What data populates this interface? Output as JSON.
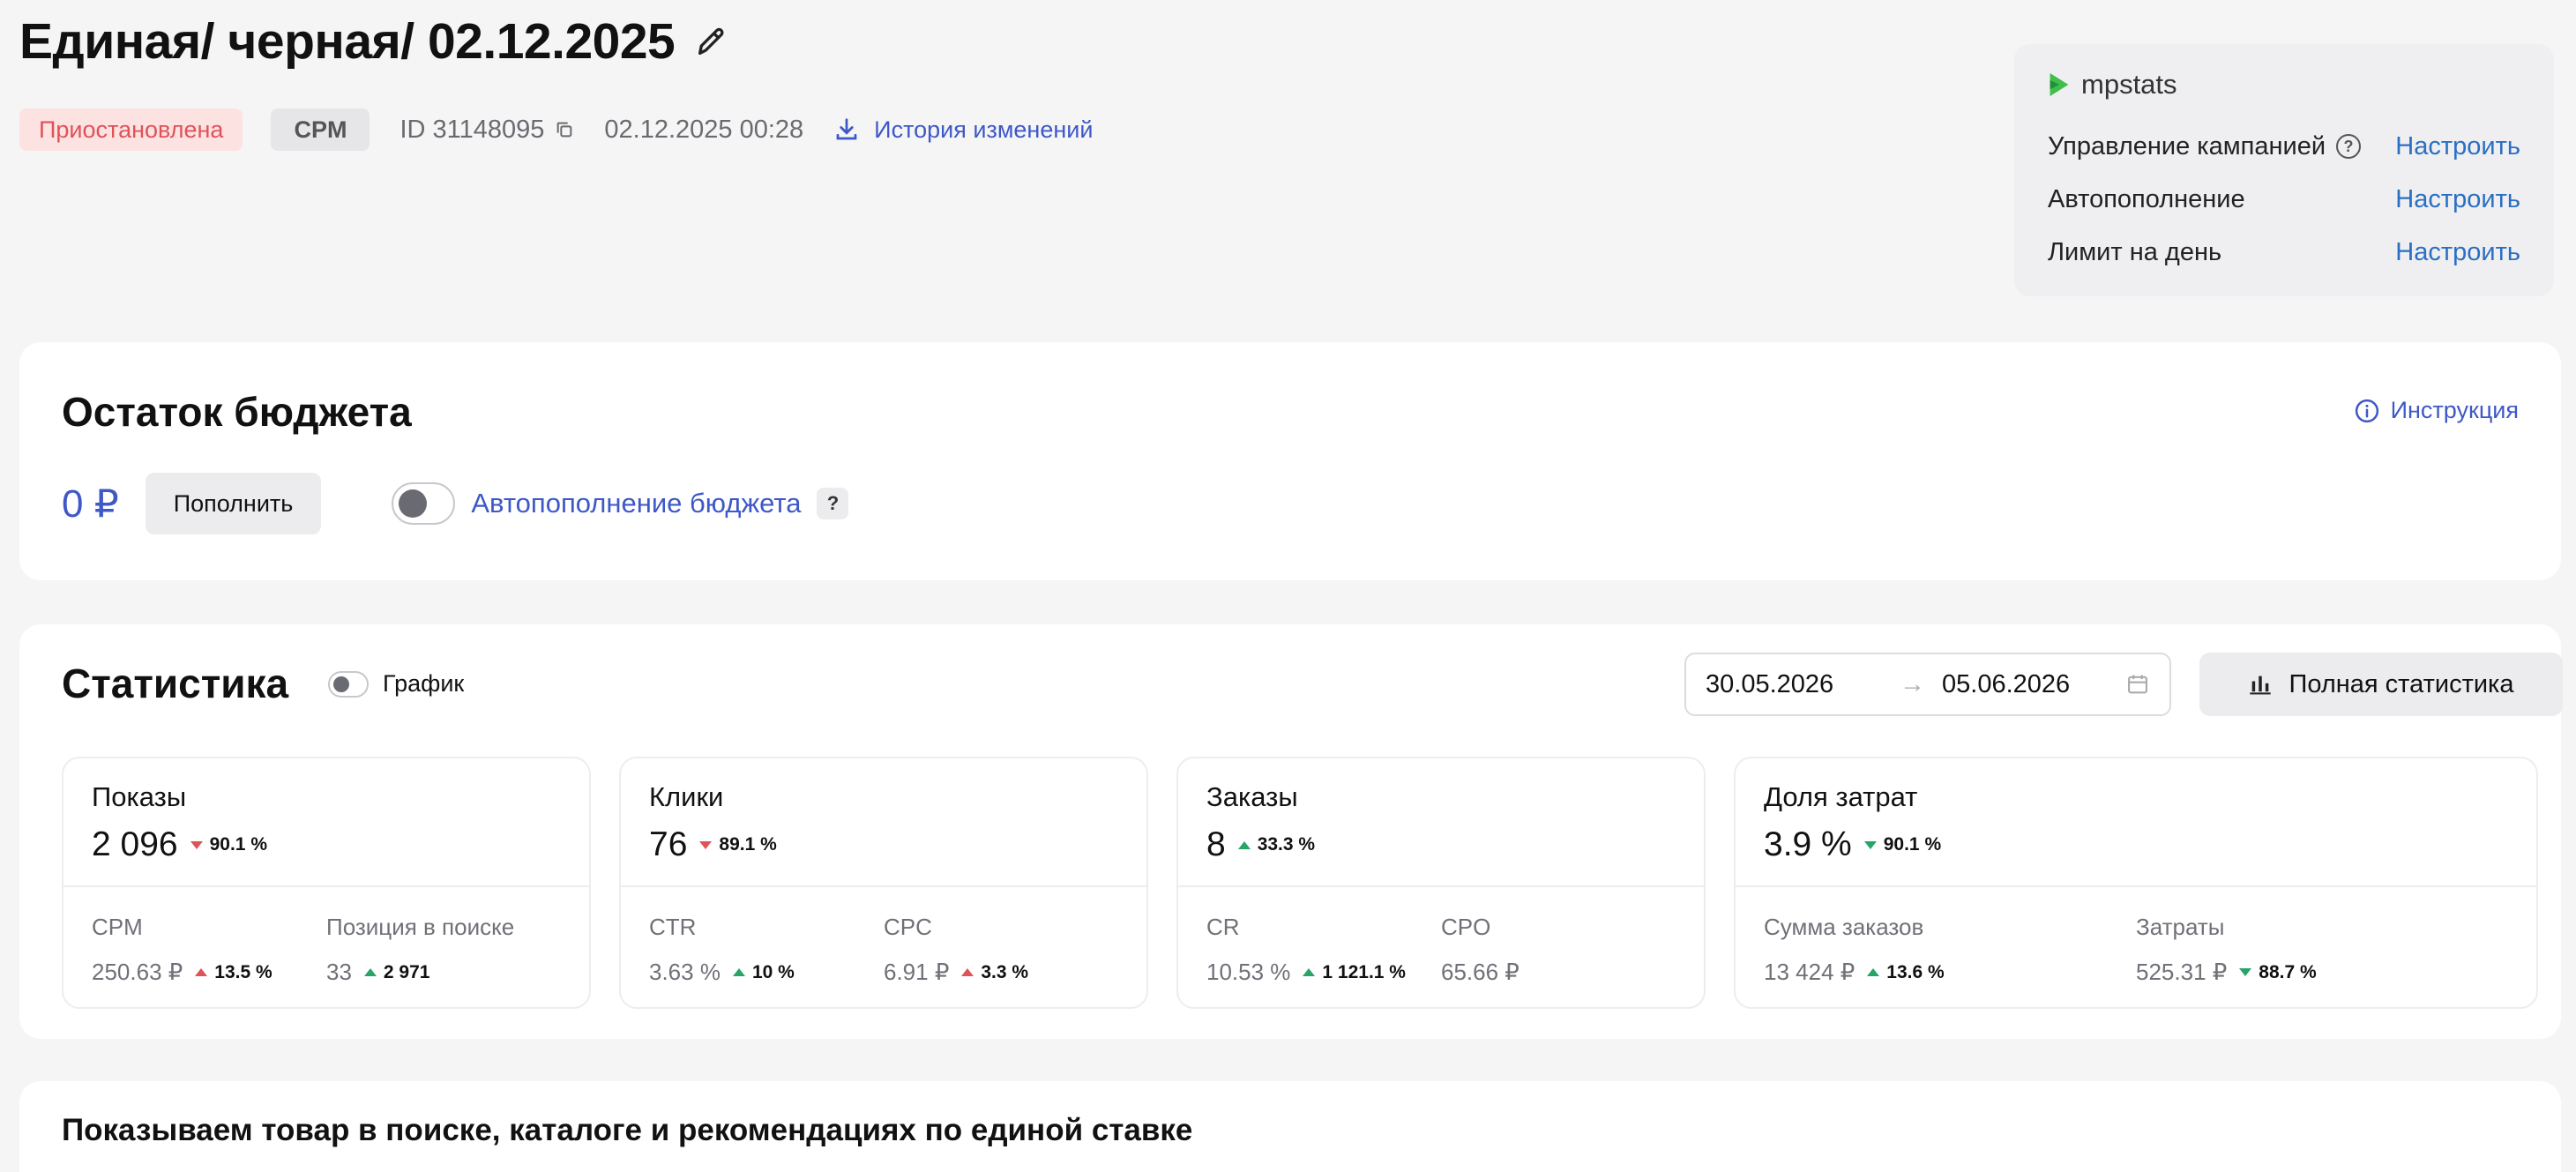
{
  "header": {
    "title": "Единая/ черная/ 02.12.2025",
    "status": "Приостановлена",
    "type": "CPM",
    "id": "ID 31148095",
    "datetime": "02.12.2025 00:28",
    "history_link": "История изменений"
  },
  "mpstats": {
    "brand": "mpstats",
    "rows": [
      {
        "label": "Управление кампанией",
        "action": "Настроить"
      },
      {
        "label": "Автопополнение",
        "action": "Настроить"
      },
      {
        "label": "Лимит на день",
        "action": "Настроить"
      }
    ]
  },
  "budget": {
    "title": "Остаток бюджета",
    "instruction": "Инструкция",
    "amount": "0 ₽",
    "topup_button": "Пополнить",
    "auto_topup_label": "Автопополнение бюджета",
    "help": "?"
  },
  "stats": {
    "title": "Статистика",
    "chart_toggle_label": "График",
    "date_from": "30.05.2026",
    "date_arrow": "→",
    "date_to": "05.06.2026",
    "full_stats_button": "Полная статистика",
    "metrics": [
      {
        "name": "Показы",
        "value": "2 096",
        "delta": "90.1 %",
        "subs": [
          {
            "label": "CPM",
            "value": "250.63 ₽",
            "delta": "13.5 %"
          },
          {
            "label": "Позиция в поиске",
            "value": "33",
            "delta": "2 971"
          }
        ]
      },
      {
        "name": "Клики",
        "value": "76",
        "delta": "89.1 %",
        "subs": [
          {
            "label": "CTR",
            "value": "3.63 %",
            "delta": "10 %"
          },
          {
            "label": "CPC",
            "value": "6.91 ₽",
            "delta": "3.3 %"
          }
        ]
      },
      {
        "name": "Заказы",
        "value": "8",
        "delta": "33.3 %",
        "subs": [
          {
            "label": "CR",
            "value": "10.53 %",
            "delta": "1 121.1 %"
          },
          {
            "label": "CPO",
            "value": "65.66 ₽",
            "delta": ""
          }
        ]
      },
      {
        "name": "Доля затрат",
        "value": "3.9 %",
        "delta": "90.1 %",
        "subs": [
          {
            "label": "Сумма заказов",
            "value": "13 424 ₽",
            "delta": "13.6 %"
          },
          {
            "label": "Затраты",
            "value": "525.31 ₽",
            "delta": "88.7 %"
          }
        ]
      }
    ]
  },
  "bottom": {
    "text": "Показываем товар в поиске, каталоге и рекомендациях по единой ставке"
  },
  "colors": {
    "accent_blue": "#3e58c8",
    "link_blue": "#2a6fc4",
    "status_red": "#e0525a",
    "positive_green": "#27a567"
  }
}
